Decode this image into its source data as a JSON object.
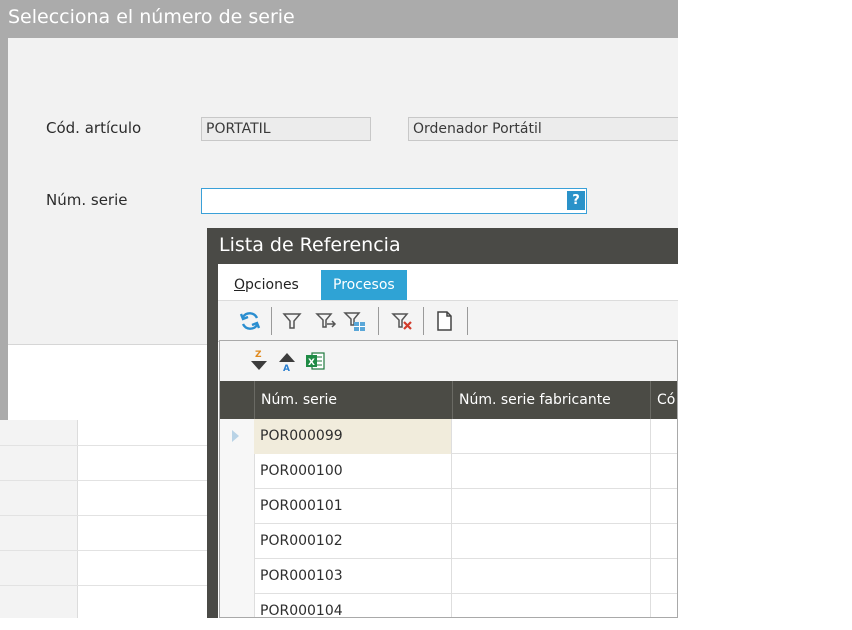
{
  "dialog": {
    "title": "Selecciona el número de serie",
    "articulo_label": "Cód. artículo",
    "articulo_code": "PORTATIL",
    "articulo_desc": "Ordenador Portátil",
    "serie_label": "Núm. serie",
    "serie_value": "",
    "help_button": "?"
  },
  "reference_list": {
    "title": "Lista de Referencia",
    "tabs": [
      {
        "label_prefix": "",
        "label_underlined": "O",
        "label_rest": "pciones"
      },
      {
        "label": "Procesos"
      }
    ],
    "toolbar_icons": [
      "refresh-icon",
      "filter-icon",
      "filter-apply-icon",
      "filter-grid-icon",
      "clear-filter-icon",
      "new-document-icon"
    ],
    "grid_tools_icons": [
      "sort-descending-icon",
      "sort-ascending-icon",
      "excel-export-icon"
    ],
    "columns": [
      "Núm. serie",
      "Núm. serie fabricante",
      "Có"
    ],
    "rows": [
      {
        "serie": "POR000099",
        "fabricante": ""
      },
      {
        "serie": "POR000100",
        "fabricante": ""
      },
      {
        "serie": "POR000101",
        "fabricante": ""
      },
      {
        "serie": "POR000102",
        "fabricante": ""
      },
      {
        "serie": "POR000103",
        "fabricante": ""
      },
      {
        "serie": "POR000104",
        "fabricante": ""
      }
    ]
  },
  "colors": {
    "accent": "#2fa3d5",
    "dialog_frame": "#ababab",
    "list_frame": "#4a4a46",
    "current_row": "#f1ecdc"
  }
}
